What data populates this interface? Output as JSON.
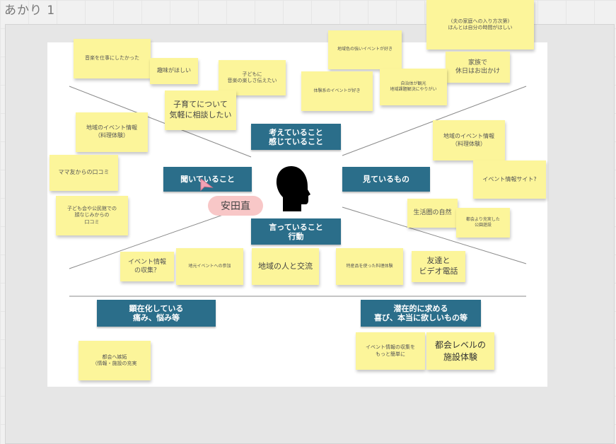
{
  "frame": {
    "title": "あかり 1"
  },
  "persona": {
    "name": "安田直"
  },
  "labels": {
    "think": "考えていること\n感じていること",
    "hear": "聞いていること",
    "see": "見ているもの",
    "say": "言っていること\n行動",
    "pain": "顕在化している\n痛み、悩み等",
    "gain": "潜在的に求める\n喜び、本当に欲しいもの等"
  },
  "notes": {
    "n01": "(夫の家庭への入り方次第)\nほんとは自分の時間がほしい",
    "n02": "家族で\n休日はお出かけ",
    "n03": "地域色の強いイベントが好き",
    "n04": "音楽を仕事にしたかった",
    "n05": "趣味がほしい",
    "n06": "子どもに\n音楽の楽しさ伝えたい",
    "n07": "体験系のイベントが好き",
    "n08": "自治体が観光\n地域課題解決にやりがい",
    "n09": "子育てについて\n気軽に相談したい",
    "n10": "地域のイベント情報\n（料理体験）",
    "n11": "ママ友からの口コミ",
    "n12": "子ども会や公民館での\n顔なじみからの\n口コミ",
    "n13": "地域のイベント情報\n（料理体験）",
    "n14": "イベント情報サイト?",
    "n15": "生活圏の自然",
    "n16": "都会より充実した\n公園遊設",
    "n17": "イベント情報\nの収集？",
    "n18": "地元イベントへの参加",
    "n19": "地域の人と交流",
    "n20": "特産品を使った料理体験",
    "n21": "友達と\nビデオ電話",
    "n22": "都会へ嫉妬\n（情報・施設の充実",
    "n23": "イベント情報の収集を\nもっと簡単に",
    "n24": "都会レベルの\n施設体験"
  }
}
